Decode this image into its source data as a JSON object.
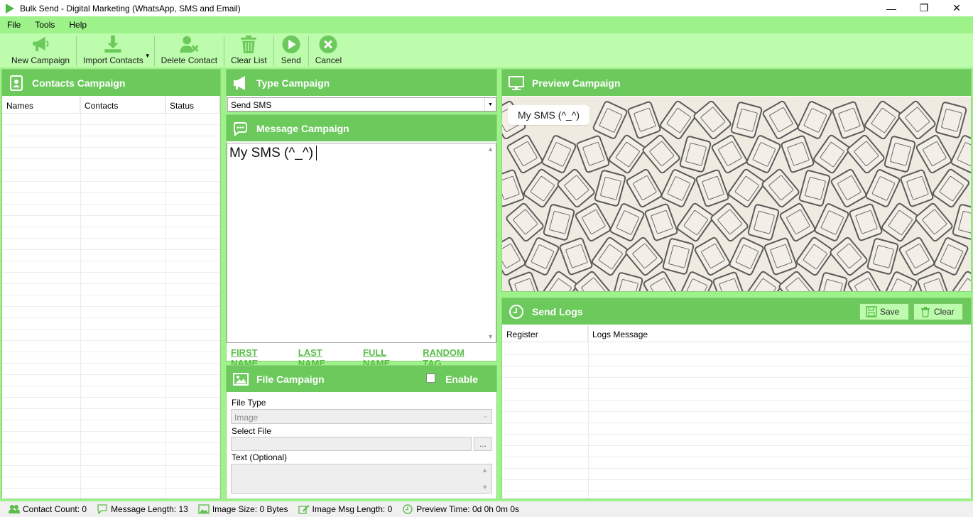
{
  "window": {
    "title": "Bulk Send - Digital Marketing (WhatsApp, SMS and Email)",
    "minimize": "—",
    "restore": "❐",
    "close": "✕"
  },
  "menu": [
    "File",
    "Tools",
    "Help"
  ],
  "toolbar": {
    "new_campaign": "New Campaign",
    "import_contacts": "Import Contacts",
    "delete_contact": "Delete Contact",
    "clear_list": "Clear List",
    "send": "Send",
    "cancel": "Cancel"
  },
  "contacts": {
    "title": "Contacts Campaign",
    "columns": [
      "Names",
      "Contacts",
      "Status"
    ]
  },
  "type_campaign": {
    "title": "Type Campaign",
    "selected": "Send SMS"
  },
  "message_campaign": {
    "title": "Message Campaign",
    "text": "My SMS (^_^)",
    "tags": [
      "FIRST NAME",
      "LAST NAME",
      "FULL NAME",
      "RANDOM TAG"
    ]
  },
  "file_campaign": {
    "title": "File Campaign",
    "enable_label": "Enable",
    "file_type_label": "File Type",
    "file_type_value": "Image",
    "select_file_label": "Select File",
    "browse_label": "...",
    "text_label": "Text (Optional)"
  },
  "preview": {
    "title": "Preview Campaign",
    "bubble_text": "My SMS (^_^)"
  },
  "send_logs": {
    "title": "Send Logs",
    "save_label": "Save",
    "clear_label": "Clear",
    "columns": [
      "Register",
      "Logs Message"
    ]
  },
  "status": {
    "contact_count": "Contact Count: 0",
    "message_length": "Message Length: 13",
    "image_size": "Image Size: 0 Bytes",
    "image_msg_length": "Image Msg Length: 0",
    "preview_time": "Preview Time: 0d 0h 0m 0s"
  },
  "colors": {
    "accent": "#6cc95c",
    "menubar": "#9ef28a",
    "toolbar": "#bdfcac",
    "link": "#5bbd4a"
  }
}
